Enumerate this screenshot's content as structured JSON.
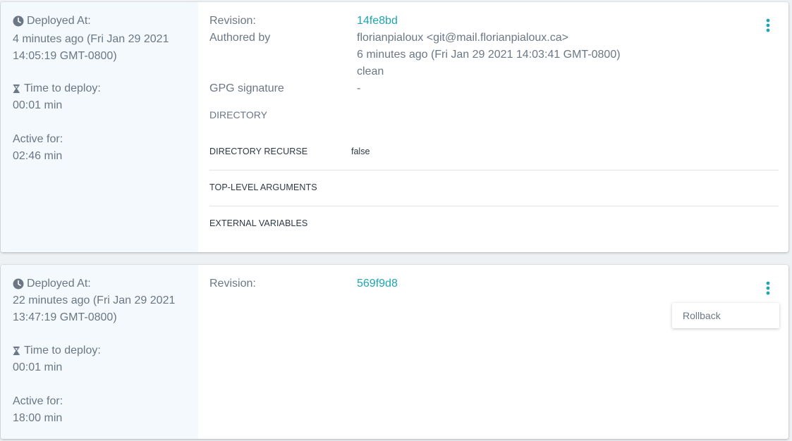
{
  "colors": {
    "link": "#1ea5b0",
    "icon": "#1ea5b0",
    "text": "#6b7785",
    "left_panel_bg": "#f3f9fc"
  },
  "deployments": [
    {
      "deployed_at_label": "Deployed At:",
      "deployed_at_line1": "4 minutes ago (Fri Jan 29 2021",
      "deployed_at_line2": "14:05:19 GMT-0800)",
      "time_to_deploy_label": "Time to deploy:",
      "time_to_deploy_value": "00:01 min",
      "active_for_label": "Active for:",
      "active_for_value": "02:46 min",
      "revision_label": "Revision:",
      "revision_value": "14fe8bd",
      "authored_by_label": "Authored by",
      "authored_by_value": "florianpialoux <git@mail.florianpialoux.ca>",
      "authored_time": "6 minutes ago (Fri Jan 29 2021 14:03:41 GMT-0800)",
      "authored_status": "clean",
      "gpg_label": "GPG signature",
      "gpg_value": "-",
      "directory_label": "DIRECTORY",
      "directory_recurse_label": "DIRECTORY RECURSE",
      "directory_recurse_value": "false",
      "top_level_args_label": "TOP-LEVEL ARGUMENTS",
      "external_vars_label": "EXTERNAL VARIABLES",
      "menu_icon": "kebab-menu-icon"
    },
    {
      "deployed_at_label": "Deployed At:",
      "deployed_at_line1": "22 minutes ago (Fri Jan 29 2021",
      "deployed_at_line2": "13:47:19 GMT-0800)",
      "time_to_deploy_label": "Time to deploy:",
      "time_to_deploy_value": "00:01 min",
      "active_for_label": "Active for:",
      "active_for_value": "18:00 min",
      "revision_label": "Revision:",
      "revision_value": "569f9d8",
      "menu_icon": "kebab-menu-icon",
      "menu_items": [
        "Rollback"
      ]
    }
  ]
}
